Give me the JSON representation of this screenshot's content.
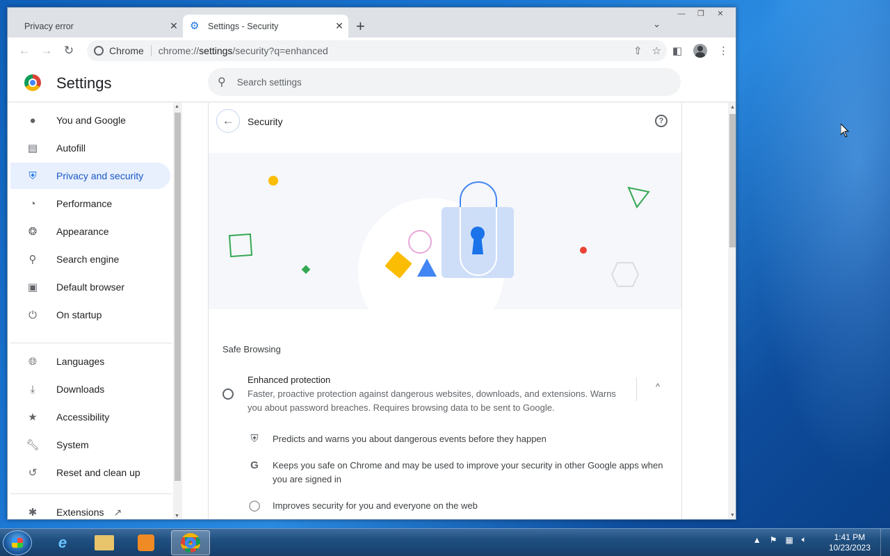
{
  "browser": {
    "tabs": [
      {
        "title": "Privacy error",
        "active": false
      },
      {
        "title": "Settings - Security",
        "active": true
      }
    ],
    "omnibox": {
      "chip": "Chrome",
      "url_prefix": "chrome://",
      "url_main": "settings",
      "url_rest": "/security?q=enhanced"
    }
  },
  "settings": {
    "title": "Settings",
    "search_placeholder": "Search settings",
    "sidebar": {
      "items": [
        {
          "label": "You and Google",
          "icon": "person-icon"
        },
        {
          "label": "Autofill",
          "icon": "clipboard-icon"
        },
        {
          "label": "Privacy and security",
          "icon": "shield-icon",
          "active": true
        },
        {
          "label": "Performance",
          "icon": "speedometer-icon"
        },
        {
          "label": "Appearance",
          "icon": "palette-icon"
        },
        {
          "label": "Search engine",
          "icon": "search-icon"
        },
        {
          "label": "Default browser",
          "icon": "browser-icon"
        },
        {
          "label": "On startup",
          "icon": "power-icon"
        },
        {
          "label": "Languages",
          "icon": "globe-icon"
        },
        {
          "label": "Downloads",
          "icon": "download-icon"
        },
        {
          "label": "Accessibility",
          "icon": "accessibility-icon"
        },
        {
          "label": "System",
          "icon": "wrench-icon"
        },
        {
          "label": "Reset and clean up",
          "icon": "history-icon"
        },
        {
          "label": "Extensions",
          "icon": "puzzle-icon"
        }
      ]
    },
    "page": {
      "title": "Security",
      "section": "Safe Browsing",
      "option": {
        "title": "Enhanced protection",
        "desc": "Faster, proactive protection against dangerous websites, downloads, and extensions. Warns you about password breaches. Requires browsing data to be sent to Google."
      },
      "bullets": [
        {
          "text": "Predicts and warns you about dangerous events before they happen",
          "icon": "shield-icon"
        },
        {
          "text": "Keeps you safe on Chrome and may be used to improve your security in other Google apps when you are signed in",
          "icon": "google-g-icon"
        },
        {
          "text": "Improves security for you and everyone on the web",
          "icon": "globe-icon"
        }
      ]
    }
  },
  "taskbar": {
    "time": "1:41 PM",
    "date": "10/23/2023"
  },
  "colors": {
    "accent": "#1a73e8",
    "active_bg": "#e8f0fe"
  }
}
